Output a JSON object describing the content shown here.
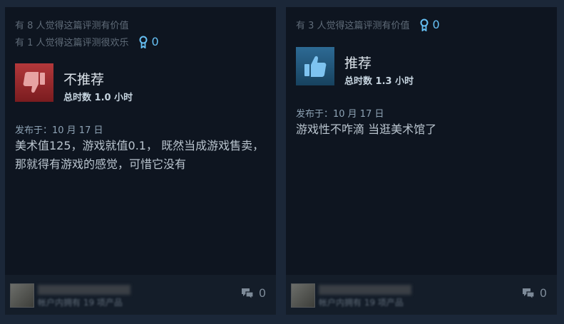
{
  "reviews": [
    {
      "helpful_text": "有 8 人觉得这篇评测有价值",
      "funny_text": "有 1 人觉得这篇评测很欢乐",
      "award_count": "0",
      "verdict": "不推荐",
      "verdict_icon": "thumbs-down-icon",
      "hours": "总时数 1.0 小时",
      "posted": "发布于：10 月 17 日",
      "text": "美术值125，游戏就值0.1， 既然当成游戏售卖，那就得有游戏的感觉，可惜它没有",
      "footer": {
        "products": "帐户内拥有 19 项产品",
        "comment_count": "0"
      }
    },
    {
      "helpful_text": "有 3 人觉得这篇评测有价值",
      "award_count": "0",
      "verdict": "推荐",
      "verdict_icon": "thumbs-up-icon",
      "hours": "总时数 1.3 小时",
      "posted": "发布于：10 月 17 日",
      "text": "游戏性不咋滴 当逛美术馆了",
      "footer": {
        "products": "帐户内拥有 19 项产品",
        "comment_count": "0"
      }
    }
  ],
  "colors": {
    "page_bg": "#1b2738",
    "card_bg": "#0e1520",
    "award_blue": "#66c0f4",
    "negative_red": "#b3383b",
    "positive_blue": "#2d6a94"
  }
}
